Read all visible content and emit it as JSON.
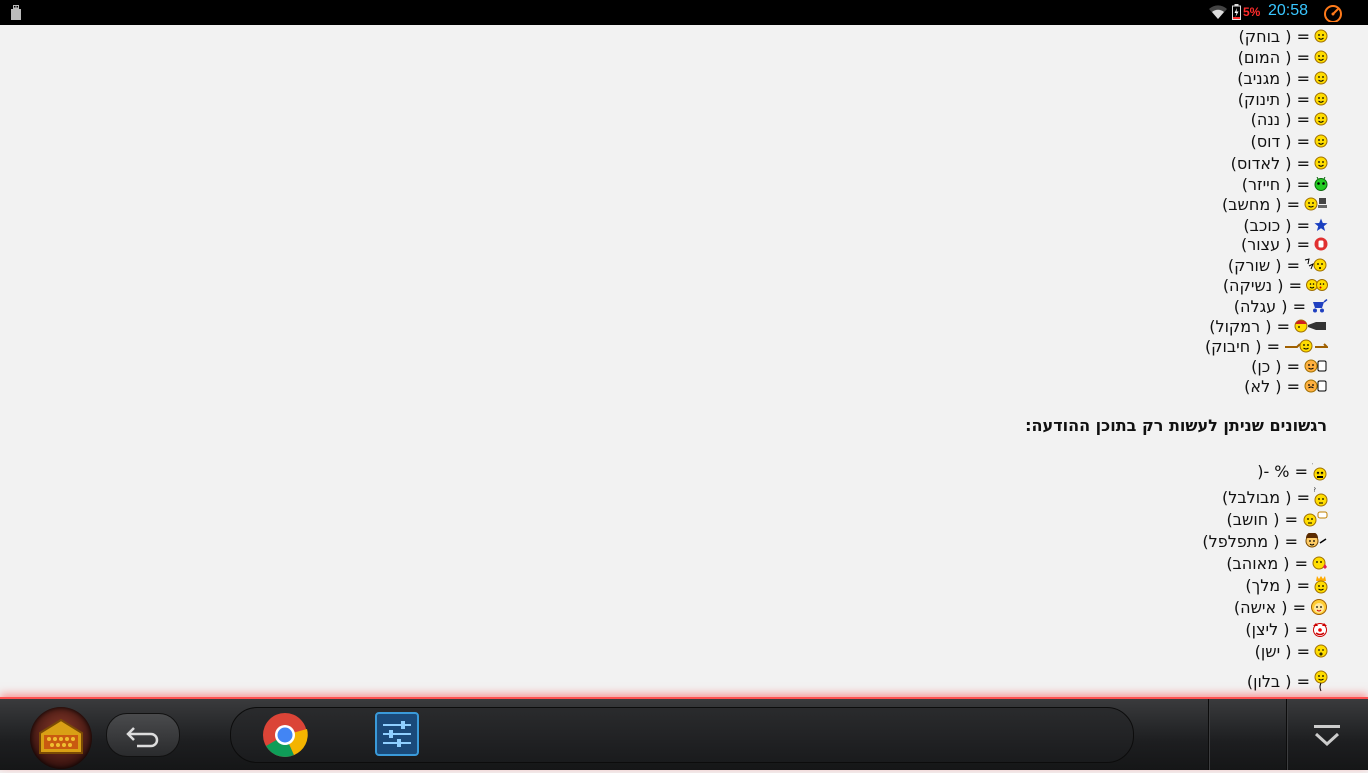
{
  "status_bar": {
    "battery_percent": "5%",
    "time": "20:58",
    "icons": [
      "usb-icon",
      "wifi-icon",
      "battery-charging-icon",
      "speed-gauge-icon"
    ]
  },
  "emoticons_basic": [
    {
      "label": "= ( בוחק)",
      "icon": "laughing-face"
    },
    {
      "label": "= ( המום)",
      "icon": "shocked-face"
    },
    {
      "label": "= ( מגניב)",
      "icon": "cool-face"
    },
    {
      "label": "= ( תינוק)",
      "icon": "baby-face"
    },
    {
      "label": "= ( ננה)",
      "icon": "tongue-face"
    },
    {
      "label": "= ( דוס)",
      "icon": "religious-face"
    },
    {
      "label": "= ( לאדוס)",
      "icon": "not-religious-face"
    },
    {
      "label": "= ( חייזר)",
      "icon": "alien-face"
    },
    {
      "label": "= ( מחשב)",
      "icon": "computer-face"
    },
    {
      "label": "= ( כוכב)",
      "icon": "star"
    },
    {
      "label": "= ( עצור)",
      "icon": "stop-hand"
    },
    {
      "label": "= ( שורק)",
      "icon": "whistling-face"
    },
    {
      "label": "= ( נשיקה)",
      "icon": "kiss-faces"
    },
    {
      "label": "= ( עגלה)",
      "icon": "stroller"
    },
    {
      "label": "= ( רמקול)",
      "icon": "megaphone-face"
    },
    {
      "label": "= ( חיבוק)",
      "icon": "hug-face"
    },
    {
      "label": "= ( כן)",
      "icon": "yes-face"
    },
    {
      "label": "= ( לא)",
      "icon": "no-face"
    }
  ],
  "section_title": "רגשונים שניתן לעשות רק בתוכן ההודעה:",
  "emoticons_message_only": [
    {
      "label": "= % -(",
      "icon": "confused-symbols-face"
    },
    {
      "label": "= ( מבולבל)",
      "icon": "question-face"
    },
    {
      "label": "= ( חושב)",
      "icon": "thinking-face"
    },
    {
      "label": "= ( מתפלפל)",
      "icon": "arguing-face"
    },
    {
      "label": "= ( מאוהב)",
      "icon": "in-love-face"
    },
    {
      "label": "= ( מלך)",
      "icon": "king-face"
    },
    {
      "label": "= ( אישה)",
      "icon": "woman-face"
    },
    {
      "label": "= ( ליצן)",
      "icon": "clown-face"
    },
    {
      "label": "= ( ישן)",
      "icon": "sleeping-face"
    },
    {
      "label": "= ( בלון)",
      "icon": "balloon-face"
    }
  ],
  "nav_bar": {
    "apps": [
      "home-button",
      "back-button",
      "chrome-app",
      "settings-app",
      "menu-down-button"
    ]
  },
  "colors": {
    "status_bg": "#000000",
    "time": "#39c6ff",
    "battery_low": "#ff2b2b",
    "emoji_yellow": "#ffdd00",
    "nav_glow": "#ff5050"
  }
}
